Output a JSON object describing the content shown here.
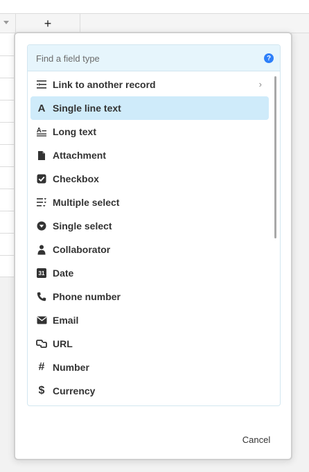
{
  "grid": {
    "add_field_label": "+"
  },
  "picker": {
    "search_placeholder": "Find a field type",
    "help_label": "?",
    "items": [
      {
        "label": "Link to another record",
        "icon": "link-record-icon",
        "has_submenu": true,
        "chevron": "›"
      },
      {
        "label": "Single line text",
        "icon": "single-line-text-icon",
        "selected": true,
        "glyph": "A"
      },
      {
        "label": "Long text",
        "icon": "long-text-icon"
      },
      {
        "label": "Attachment",
        "icon": "attachment-icon"
      },
      {
        "label": "Checkbox",
        "icon": "checkbox-icon"
      },
      {
        "label": "Multiple select",
        "icon": "multiple-select-icon"
      },
      {
        "label": "Single select",
        "icon": "single-select-icon"
      },
      {
        "label": "Collaborator",
        "icon": "collaborator-icon"
      },
      {
        "label": "Date",
        "icon": "date-icon",
        "glyph": "31"
      },
      {
        "label": "Phone number",
        "icon": "phone-icon"
      },
      {
        "label": "Email",
        "icon": "email-icon"
      },
      {
        "label": "URL",
        "icon": "url-icon"
      },
      {
        "label": "Number",
        "icon": "number-icon",
        "glyph": "#"
      },
      {
        "label": "Currency",
        "icon": "currency-icon",
        "glyph": "$"
      }
    ]
  },
  "dialog": {
    "cancel_label": "Cancel"
  },
  "colors": {
    "selected_bg": "#cfebfa",
    "search_bg": "#e6f5fc",
    "help_blue": "#2d7ff9"
  }
}
